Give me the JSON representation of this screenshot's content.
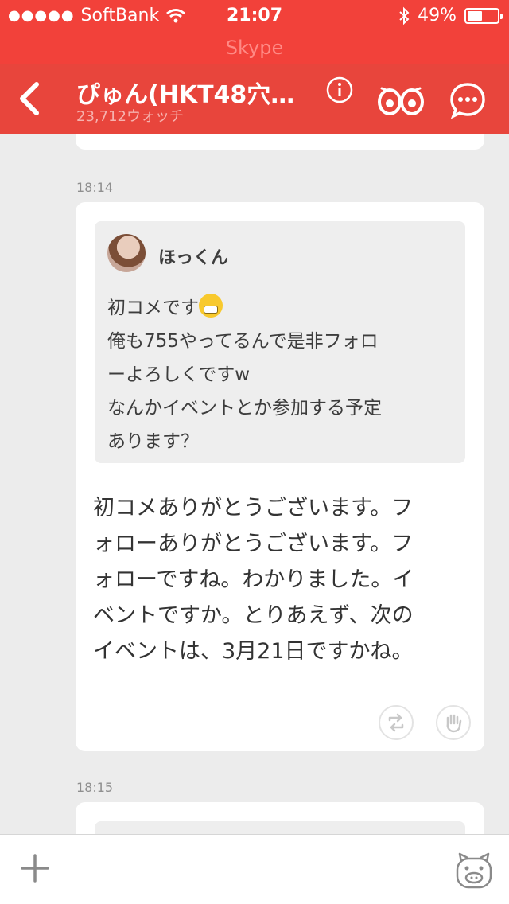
{
  "status_bar": {
    "signal": "●●●●●",
    "carrier": "SoftBank",
    "time": "21:07",
    "battery": "49%",
    "battery_level": 0.49
  },
  "banner": {
    "text": "Skype"
  },
  "nav": {
    "title": "ぴゅん(HKT48穴…",
    "subtitle": "23,712ウォッチ"
  },
  "timestamps": [
    "18:14",
    "18:15"
  ],
  "post": {
    "quote_author": "ほっくん",
    "quote_lines": [
      "初コメです",
      "俺も755やってるんで是非フォロ",
      "ーよろしくですw",
      "なんかイベントとか参加する予定",
      "あります？"
    ],
    "reply_lines": [
      "初コメありがとうございます。フ",
      "ォローありがとうございます。フ",
      "ォローですね。わかりました。イ",
      "ベントですか。とりあえず、次の",
      "イベントは、3月21日ですかね。"
    ]
  },
  "accent_color": "#e8453c"
}
